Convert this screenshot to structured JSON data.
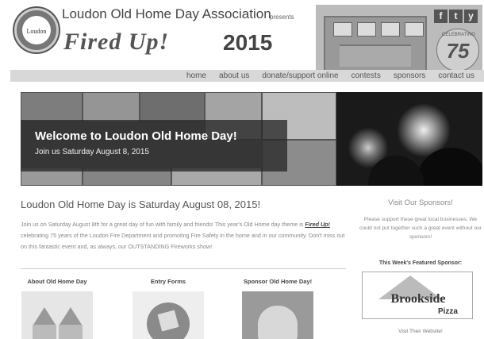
{
  "header": {
    "logo_text": "Loudon",
    "association": "Loudon Old Home Day Association",
    "presents": "presents",
    "event_name": "Fired Up!",
    "year": "2015",
    "badge_top": "CELEBRATING",
    "badge_number": "75"
  },
  "social": [
    "f",
    "t",
    "y"
  ],
  "nav": [
    "home",
    "about us",
    "donate/support online",
    "contests",
    "sponsors",
    "contact us"
  ],
  "banner": {
    "title": "Welcome to Loudon Old Home Day!",
    "subtitle": "Join us Saturday August 8, 2015"
  },
  "main": {
    "headline": "Loudon Old Home Day is Saturday August 08, 2015!",
    "intro_1": "Join us on Saturday August 8th for a great day of fun with family and friends! This year's Old Home day theme is ",
    "intro_bold": "Fired Up!",
    "intro_2": " celebrating 75 years of the Loudon Fire Department and promoting Fire Safety in the home and in our community. Don't miss out on this fantastic event and, as always, our OUTSTANDING Fireworks show!",
    "columns": [
      {
        "title": "About Old Home Day"
      },
      {
        "title": "Entry Forms"
      },
      {
        "title": "Sponsor Old Home Day!"
      }
    ]
  },
  "sidebar": {
    "title": "Visit Our Sponsors!",
    "text": "Please support these great local businesses. We could not put together such a great event without our sponsors!",
    "featured": "This Week's Featured Sponsor:",
    "sponsor_name": "Brookside",
    "sponsor_sub": "Pizza",
    "visit": "Visit Their Website!"
  }
}
